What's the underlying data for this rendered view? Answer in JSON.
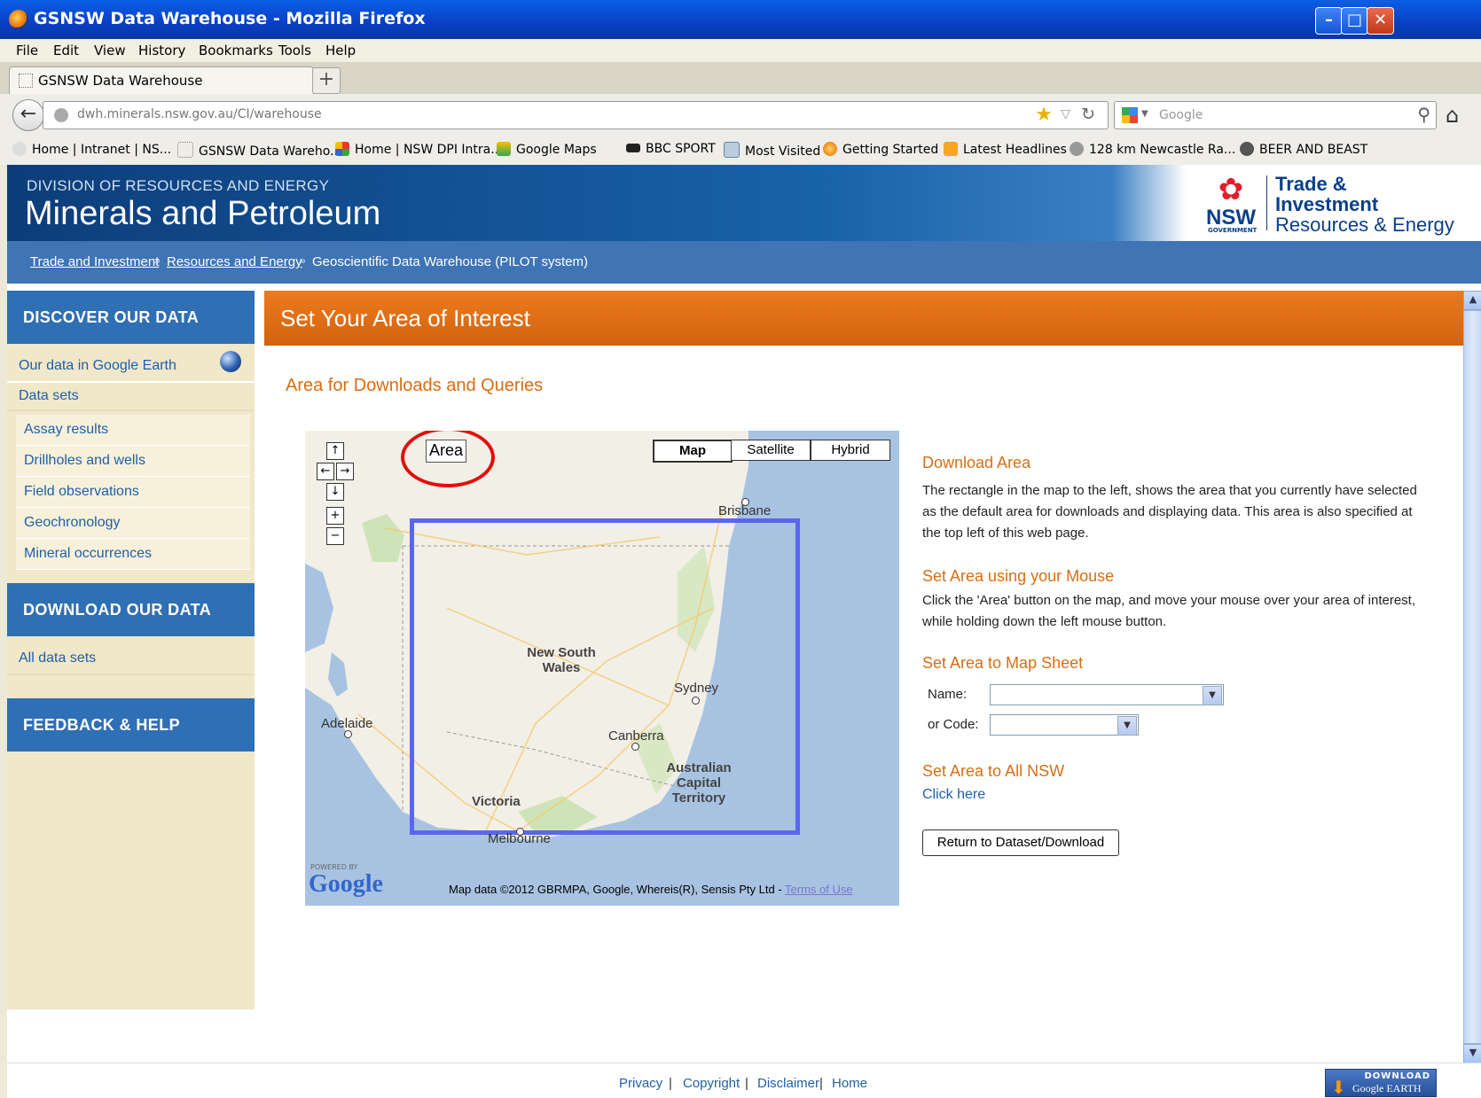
{
  "window": {
    "title": "GSNSW Data Warehouse - Mozilla Firefox",
    "controls": {
      "minimize": "–",
      "maximize": "□",
      "close": "✕"
    }
  },
  "menu": [
    "File",
    "Edit",
    "View",
    "History",
    "Bookmarks",
    "Tools",
    "Help"
  ],
  "tab": {
    "label": "GSNSW Data Warehouse",
    "new_tab": "+"
  },
  "navbar": {
    "back": "←",
    "url": "dwh.minerals.nsw.gov.au/CI/warehouse",
    "search_placeholder": "Google"
  },
  "bookmarks": [
    "Home | Intranet | NS...",
    "GSNSW Data Wareho...",
    "Home | NSW DPI Intra...",
    "Google Maps",
    "BBC SPORT",
    "Most Visited",
    "Getting Started",
    "Latest Headlines",
    "128 km Newcastle Ra...",
    "BEER AND BEAST"
  ],
  "banner": {
    "division": "DIVISION OF RESOURCES AND ENERGY",
    "brand": "Minerals and Petroleum",
    "logo_nsw": "NSW",
    "logo_gov": "GOVERNMENT",
    "logo_line1": "Trade &",
    "logo_line2": "Investment",
    "logo_line3": "Resources & Energy"
  },
  "breadcrumb": {
    "items": [
      "Trade and Investment",
      "Resources and Energy"
    ],
    "separator": "»",
    "current": "Geoscientific Data Warehouse (PILOT system)"
  },
  "sidebar": {
    "discover_heading": "DISCOVER OUR DATA",
    "discover_links": [
      "Our data in Google Earth",
      "Data sets"
    ],
    "data_sets": [
      "Assay results",
      "Drillholes and wells",
      "Field observations",
      "Geochronology",
      "Mineral occurrences"
    ],
    "download_heading": "DOWNLOAD OUR DATA",
    "download_links": [
      "All data sets"
    ],
    "feedback_heading": "FEEDBACK & HELP"
  },
  "main": {
    "title": "Set Your Area of Interest",
    "subtitle": "Area for Downloads and Queries"
  },
  "map": {
    "area_button": "Area",
    "type_buttons": [
      "Map",
      "Satellite",
      "Hybrid"
    ],
    "active_type": "Map",
    "nav_controls": [
      "↑",
      "←",
      "→",
      "↓",
      "+",
      "−"
    ],
    "labels": {
      "brisbane": "Brisbane",
      "nsw_line1": "New South",
      "nsw_line2": "Wales",
      "sydney": "Sydney",
      "adelaide": "Adelaide",
      "canberra": "Canberra",
      "act_line1": "Australian",
      "act_line2": "Capital",
      "act_line3": "Territory",
      "victoria": "Victoria",
      "melbourne": "Melbourne"
    },
    "powered_by": "POWERED BY",
    "google_logo": "Google",
    "attribution": "Map data ©2012 GBRMPA, Google, Whereis(R), Sensis Pty Ltd - ",
    "terms_link": "Terms of Use"
  },
  "right_panel": {
    "download_area_heading": "Download Area",
    "download_area_text": "The rectangle in the map to the left, shows the area that you currently have selected as the default area for downloads and displaying data. This area is also specified at the top left of this web page.",
    "mouse_heading": "Set Area using your Mouse",
    "mouse_text": "Click the 'Area' button on the map, and move your mouse over your area of interest, while holding down the left mouse button.",
    "sheet_heading": "Set Area to Map Sheet",
    "name_label": "Name:",
    "code_label": "or Code:",
    "name_value": "",
    "code_value": "",
    "all_nsw_heading": "Set Area to All NSW",
    "click_here": "Click here",
    "return_button": "Return to Dataset/Download"
  },
  "footer": {
    "links": [
      "Privacy",
      "Copyright",
      "Disclaimer",
      "Home"
    ],
    "separator": "|",
    "ge_download_line1": "DOWNLOAD",
    "ge_download_line2": "Google EARTH"
  },
  "colors": {
    "title_bar": "#0a4fd6",
    "banner_blue": "#1862a8",
    "accent_orange": "#d86e12",
    "link_blue": "#1f5fa8",
    "sidebar_bg": "#f1e7c9",
    "selection_rect": "#5a66f0",
    "annotation_circle": "#e01010"
  }
}
